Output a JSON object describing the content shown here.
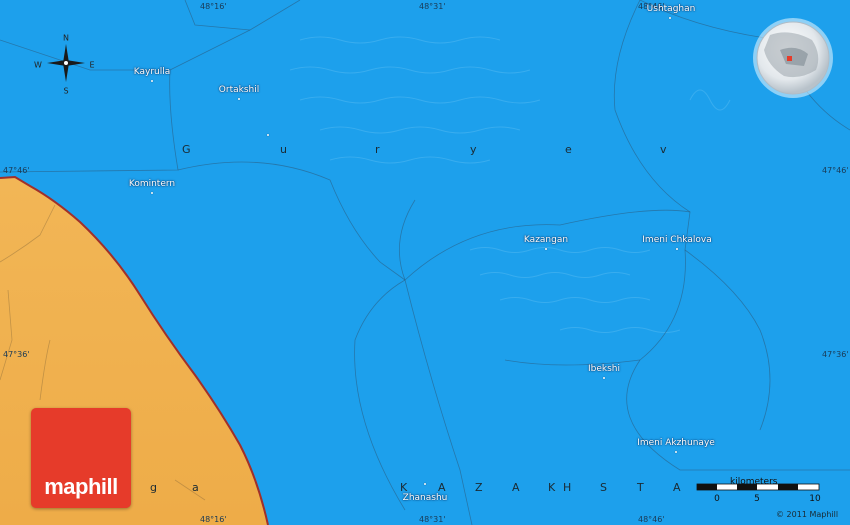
{
  "colors": {
    "water": "#1da0ec",
    "land": "#f0b050",
    "border": "#a0302a",
    "logo": "#e63b2a"
  },
  "places": [
    {
      "name": "Ushtaghan"
    },
    {
      "name": "Kayrulla"
    },
    {
      "name": "Ortakshil"
    },
    {
      "name": "Komintern"
    },
    {
      "name": "Kazangan"
    },
    {
      "name": "Imeni Chkalova"
    },
    {
      "name": "Ibekshi"
    },
    {
      "name": "Imeni Akzhunaye"
    },
    {
      "name": "Zhanashu"
    }
  ],
  "region_letters": {
    "guryev": [
      "G",
      "u",
      "r",
      "y",
      "e",
      "v"
    ],
    "kazakhstan": [
      "K",
      "A",
      "Z",
      "A",
      "K",
      "H",
      "S",
      "T",
      "A"
    ],
    "other": [
      "g",
      "a"
    ]
  },
  "coordinates": {
    "top": [
      "48°16'",
      "48°31'",
      "48°46'"
    ],
    "bottom": [
      "48°16'",
      "48°31'",
      "48°46'"
    ],
    "left": [
      "47°46'",
      "47°36'"
    ],
    "right": [
      "47°46'",
      "47°36'"
    ]
  },
  "compass": {
    "n": "N",
    "s": "S",
    "e": "E",
    "w": "W"
  },
  "scale": {
    "title": "kilometers",
    "ticks": [
      "0",
      "5",
      "10"
    ]
  },
  "logo_text": "maphill",
  "copyright": "© 2011 Maphill"
}
